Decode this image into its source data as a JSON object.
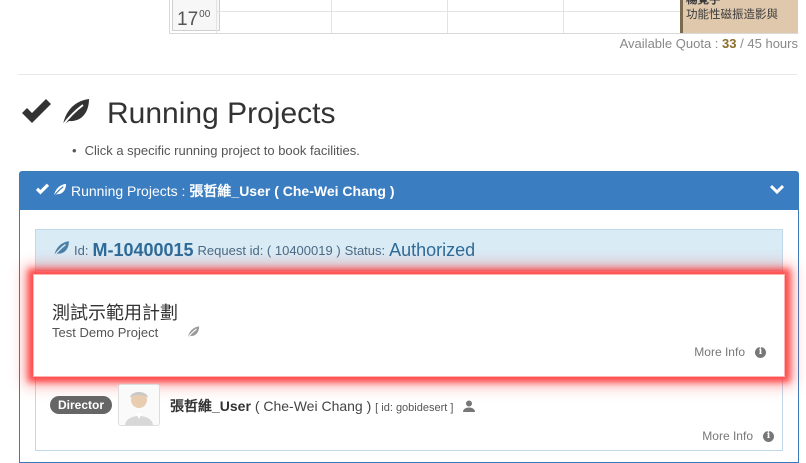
{
  "calendar": {
    "hour": "17",
    "minutes": "00",
    "booking_name": "楊覺宇",
    "booking_desc": "功能性磁振造影與"
  },
  "quota": {
    "label": "Available Quota :",
    "used": "33",
    "separator": "/",
    "total": "45",
    "unit": "hours"
  },
  "heading": {
    "title": "Running Projects",
    "hint": "Click a specific running project to book facilities."
  },
  "panel": {
    "header_label": "Running Projects :",
    "owner": "張哲維_User ( Che-Wei Chang )"
  },
  "project": {
    "id_label": "Id:",
    "id": "M-10400015",
    "request_label": "Request id: ( 10400019 )",
    "status_label": "Status:",
    "status": "Authorized",
    "zh_title": "測試示範用計劃",
    "en_title": "Test Demo Project",
    "more_info": "More Info"
  },
  "director": {
    "badge": "Director",
    "user": "張哲維_User",
    "name": "( Che-Wei Chang )",
    "id_text": "[ id: gobidesert ]",
    "more_info": "More Info"
  },
  "colors": {
    "panel_header": "#3a7ec1",
    "project_header": "#d9ebf5",
    "id_text": "#2e6b98",
    "booking_bg": "#e0c8ac",
    "highlight_glow": "#ff2828"
  },
  "icons": [
    "check-icon",
    "leaf-icon",
    "chevron-down-icon",
    "info-icon",
    "user-icon",
    "avatar-icon"
  ]
}
